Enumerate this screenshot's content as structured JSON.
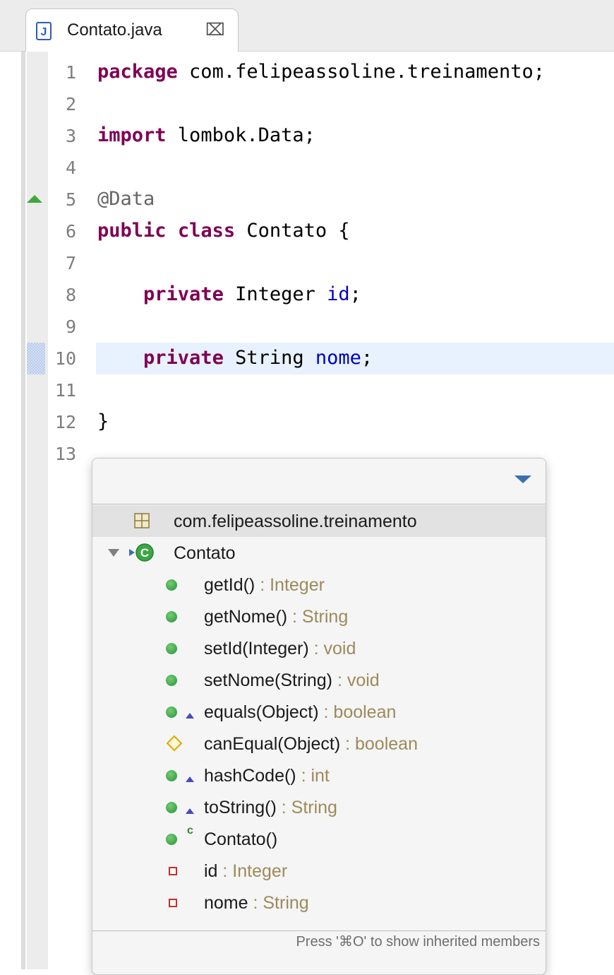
{
  "tab": {
    "title": "Contato.java",
    "close_glyph": "⌧",
    "icon": "java-file-icon"
  },
  "editor": {
    "highlighted_line": 10,
    "lines": [
      {
        "num": "1",
        "text": "package com.felipeassoline.treinamento;"
      },
      {
        "num": "2",
        "text": ""
      },
      {
        "num": "3",
        "text": "import lombok.Data;"
      },
      {
        "num": "4",
        "text": ""
      },
      {
        "num": "5",
        "text": "@Data"
      },
      {
        "num": "6",
        "text": "public class Contato {"
      },
      {
        "num": "7",
        "text": ""
      },
      {
        "num": "8",
        "text": "    private Integer id;"
      },
      {
        "num": "9",
        "text": ""
      },
      {
        "num": "10",
        "text": "    private String nome;"
      },
      {
        "num": "11",
        "text": ""
      },
      {
        "num": "12",
        "text": "}"
      },
      {
        "num": "13",
        "text": ""
      }
    ]
  },
  "outline": {
    "menu_icon": "view-menu-icon",
    "package": "com.felipeassoline.treinamento",
    "class_name": "Contato",
    "members": [
      {
        "name": "getId()",
        "type": " : Integer",
        "kind": "public-method"
      },
      {
        "name": "getNome()",
        "type": " : String",
        "kind": "public-method"
      },
      {
        "name": "setId(Integer)",
        "type": " : void",
        "kind": "public-method"
      },
      {
        "name": "setNome(String)",
        "type": " : void",
        "kind": "public-method"
      },
      {
        "name": "equals(Object)",
        "type": " : boolean",
        "kind": "override-method"
      },
      {
        "name": "canEqual(Object)",
        "type": " : boolean",
        "kind": "protected-method"
      },
      {
        "name": "hashCode()",
        "type": " : int",
        "kind": "override-method"
      },
      {
        "name": "toString()",
        "type": " : String",
        "kind": "override-method"
      },
      {
        "name": "Contato()",
        "type": "",
        "kind": "constructor"
      },
      {
        "name": "id",
        "type": " : Integer",
        "kind": "private-field"
      },
      {
        "name": "nome",
        "type": " : String",
        "kind": "private-field"
      }
    ],
    "footer": "Press '⌘O' to show inherited members"
  },
  "colors": {
    "keyword": "#7f0055",
    "field": "#0000c0",
    "type_hint": "#9c8a5a",
    "method_icon": "#2f8f3b"
  }
}
